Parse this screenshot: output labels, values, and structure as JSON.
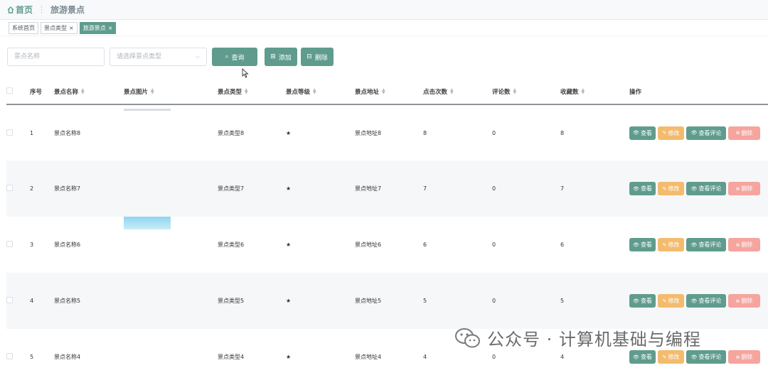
{
  "breadcrumb": {
    "home": "首页",
    "separator": "⋮",
    "current": "旅游景点"
  },
  "tabs": [
    {
      "label": "系统首页",
      "closable": false
    },
    {
      "label": "景点类型",
      "closable": true
    },
    {
      "label": "旅游景点",
      "closable": true
    }
  ],
  "filters": {
    "name_placeholder": "景点名称",
    "type_placeholder": "请选择景点类型"
  },
  "buttons": {
    "search": "查询",
    "add": "添加",
    "delete": "删除"
  },
  "table": {
    "headers": [
      "序号",
      "景点名称",
      "景点图片",
      "景点类型",
      "景点等级",
      "景点地址",
      "点击次数",
      "评论数",
      "收藏数",
      "操作"
    ],
    "rows": [
      {
        "index": "1",
        "name": "景点名称8",
        "type": "景点类型8",
        "level": "★",
        "address": "景点地址8",
        "clicks": "8",
        "comments": "0",
        "favorites": "8",
        "image": "bar"
      },
      {
        "index": "2",
        "name": "景点名称7",
        "type": "景点类型7",
        "level": "★",
        "address": "景点地址7",
        "clicks": "7",
        "comments": "0",
        "favorites": "7",
        "image": "none"
      },
      {
        "index": "3",
        "name": "景点名称6",
        "type": "景点类型6",
        "level": "★",
        "address": "景点地址6",
        "clicks": "6",
        "comments": "0",
        "favorites": "6",
        "image": "sky"
      },
      {
        "index": "4",
        "name": "景点名称5",
        "type": "景点类型5",
        "level": "★",
        "address": "景点地址5",
        "clicks": "5",
        "comments": "0",
        "favorites": "5",
        "image": "none"
      },
      {
        "index": "5",
        "name": "景点名称4",
        "type": "景点类型4",
        "level": "★",
        "address": "景点地址4",
        "clicks": "4",
        "comments": "0",
        "favorites": "4",
        "image": "none"
      }
    ],
    "row_actions": {
      "view": "查看",
      "edit": "修改",
      "comments": "查看评论",
      "delete": "删除"
    }
  },
  "watermark": "公众号 · 计算机基础与编程",
  "colors": {
    "primary": "#5f9c8e",
    "warning": "#f3bb6e",
    "danger": "#f5a49e"
  }
}
